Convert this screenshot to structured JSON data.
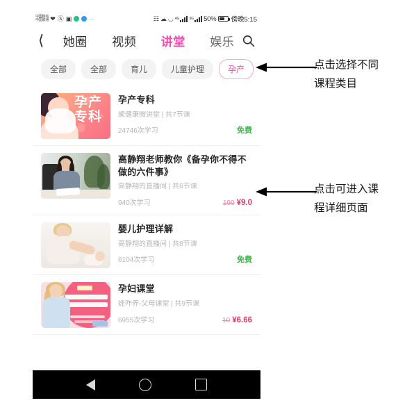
{
  "statusbar": {
    "carrier_line1": "中国移动",
    "carrier_line2": "中国联通",
    "battery_percent": "50%",
    "clock": "傍晚5:15",
    "signal_label_1": "4G",
    "signal_label_2": "3G",
    "icons": [
      "heart-icon",
      "at-icon",
      "app-icon",
      "green-dot-icon",
      "blue-dot-icon",
      "ellipsis-icon",
      "vibrate-icon",
      "bluetooth-icon",
      "wifi-icon"
    ]
  },
  "navbar": {
    "back_icon": "back-chevron-icon",
    "search_icon": "search-icon",
    "tabs": [
      {
        "label": "她圈",
        "active": false
      },
      {
        "label": "视频",
        "active": false
      },
      {
        "label": "讲堂",
        "active": true
      },
      {
        "label": "娱乐",
        "active": false
      }
    ],
    "active_color": "#f24ab0"
  },
  "chips": [
    {
      "label": "全部",
      "active": false
    },
    {
      "label": "全部",
      "active": false
    },
    {
      "label": "育儿",
      "active": false
    },
    {
      "label": "儿童护理",
      "active": false
    },
    {
      "label": "孕产",
      "active": true
    }
  ],
  "chip_active_color": "#f2509c",
  "courses": [
    {
      "title": "孕产专科",
      "subtitle": "聚健康微讲堂 | 共7节课",
      "learners": "24746次学习",
      "price_free": "免费",
      "price_old": "",
      "price_new": "",
      "thumb_text": "孕产专科"
    },
    {
      "title": "高静翔老师教你《备孕你不得不做的六件事》",
      "subtitle": "高静翔的直播间 | 共6节课",
      "learners": "940次学习",
      "price_free": "",
      "price_old": "199",
      "price_new": "¥9.0",
      "thumb_text": ""
    },
    {
      "title": "婴儿护理详解",
      "subtitle": "高静翔的直播间 | 共8节课",
      "learners": "6104次学习",
      "price_free": "免费",
      "price_old": "",
      "price_new": "",
      "thumb_text": ""
    },
    {
      "title": "孕妇课堂",
      "subtitle": "娃咋养-父母课堂 | 共9节课",
      "learners": "6955次学习",
      "price_free": "",
      "price_old": "10",
      "price_new": "¥6.66",
      "thumb_text": ""
    }
  ],
  "free_color": "#3cb54a",
  "price_color": "#f0326a",
  "android_nav": {
    "back": "back-triangle-icon",
    "home": "home-circle-icon",
    "recents": "recents-square-icon"
  },
  "annotations": [
    {
      "line1": "点击选择不同",
      "line2": "课程类目"
    },
    {
      "line1": "点击可进入课",
      "line2": "程详细页面"
    }
  ]
}
